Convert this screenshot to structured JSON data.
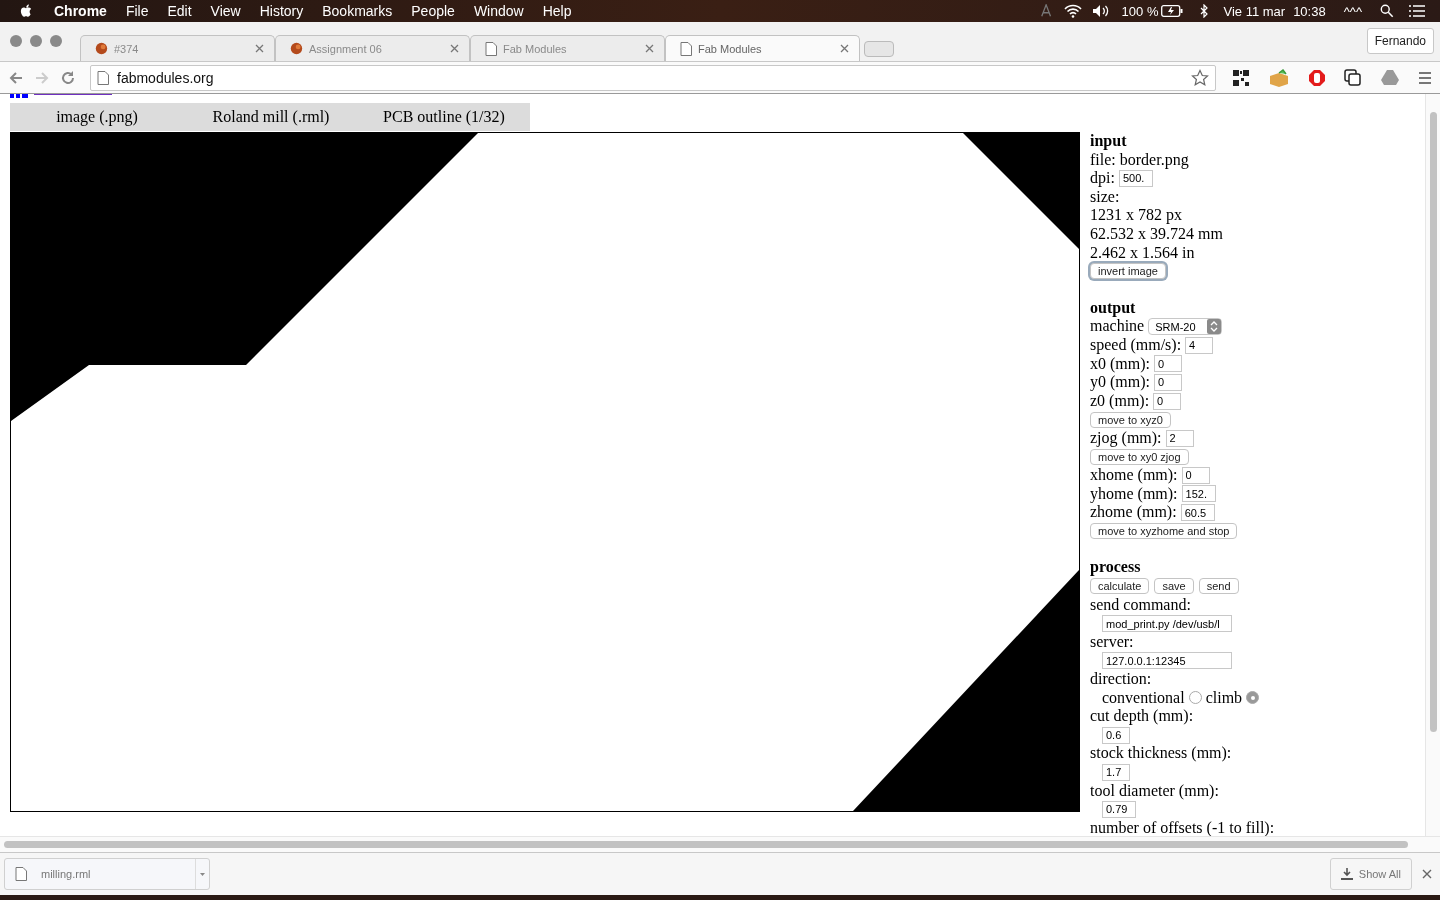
{
  "menubar": {
    "app": "Chrome",
    "items": [
      "File",
      "Edit",
      "View",
      "History",
      "Bookmarks",
      "People",
      "Window",
      "Help"
    ],
    "battery": "100 %",
    "date": "Vie 11 mar",
    "time": "10:38",
    "extra": "^^^"
  },
  "tabs": [
    {
      "title": "#374",
      "kind": "bug",
      "selected": false
    },
    {
      "title": "Assignment 06",
      "kind": "bug",
      "selected": false
    },
    {
      "title": "Fab Modules",
      "kind": "page",
      "selected": false
    },
    {
      "title": "Fab Modules",
      "kind": "page",
      "selected": true
    }
  ],
  "profile": "Fernando",
  "address": "fabmodules.org",
  "format_tabs": [
    "image (.png)",
    "Roland mill (.rml)",
    "PCB outline (1/32)"
  ],
  "panel": [
    {
      "kind": "heading",
      "text": "input"
    },
    {
      "kind": "text",
      "text": "file: border.png"
    },
    {
      "kind": "field",
      "label": "dpi:",
      "value": "500."
    },
    {
      "kind": "text",
      "text": "size:"
    },
    {
      "kind": "text",
      "text": "1231 x 782 px"
    },
    {
      "kind": "text",
      "text": "62.532 x 39.724 mm"
    },
    {
      "kind": "text",
      "text": "2.462 x 1.564 in"
    },
    {
      "kind": "button",
      "labels": [
        "invert image"
      ],
      "focused": true
    },
    {
      "kind": "heading",
      "text": "output"
    },
    {
      "kind": "select",
      "label": "machine",
      "value": "SRM-20"
    },
    {
      "kind": "field",
      "label": "speed (mm/s):",
      "value": "4"
    },
    {
      "kind": "field",
      "label": "x0 (mm):",
      "value": "0"
    },
    {
      "kind": "field",
      "label": "y0 (mm):",
      "value": "0"
    },
    {
      "kind": "field",
      "label": "z0 (mm):",
      "value": "0"
    },
    {
      "kind": "button",
      "labels": [
        "move to xyz0"
      ],
      "focused": false
    },
    {
      "kind": "field",
      "label": "zjog (mm):",
      "value": "2"
    },
    {
      "kind": "button",
      "labels": [
        "move to xy0 zjog"
      ],
      "focused": false
    },
    {
      "kind": "field",
      "label": "xhome (mm):",
      "value": "0"
    },
    {
      "kind": "field",
      "label": "yhome (mm):",
      "value": "152."
    },
    {
      "kind": "field",
      "label": "zhome (mm):",
      "value": "60.5"
    },
    {
      "kind": "button",
      "labels": [
        "move to xyzhome and stop"
      ],
      "focused": false
    },
    {
      "kind": "heading",
      "text": "process"
    },
    {
      "kind": "button",
      "labels": [
        "calculate",
        "save",
        "send"
      ],
      "focused": false
    },
    {
      "kind": "text",
      "text": "send command:"
    },
    {
      "kind": "input",
      "value": "mod_print.py /dev/usb/l"
    },
    {
      "kind": "text",
      "text": "server:"
    },
    {
      "kind": "input",
      "value": "127.0.0.1:12345"
    },
    {
      "kind": "text",
      "text": "direction:"
    },
    {
      "kind": "radios",
      "options": [
        {
          "label": "conventional",
          "selected": false
        },
        {
          "label": "climb",
          "selected": true
        }
      ]
    },
    {
      "kind": "text",
      "text": "cut depth (mm):"
    },
    {
      "kind": "input",
      "value": "0.6"
    },
    {
      "kind": "text",
      "text": "stock thickness (mm):"
    },
    {
      "kind": "input",
      "value": "1.7"
    },
    {
      "kind": "text",
      "text": "tool diameter (mm):"
    },
    {
      "kind": "input",
      "value": "0.79"
    },
    {
      "kind": "text",
      "text": "number of offsets (-1 to fill):"
    }
  ],
  "download": {
    "file": "milling.rml",
    "show_all": "Show All"
  }
}
